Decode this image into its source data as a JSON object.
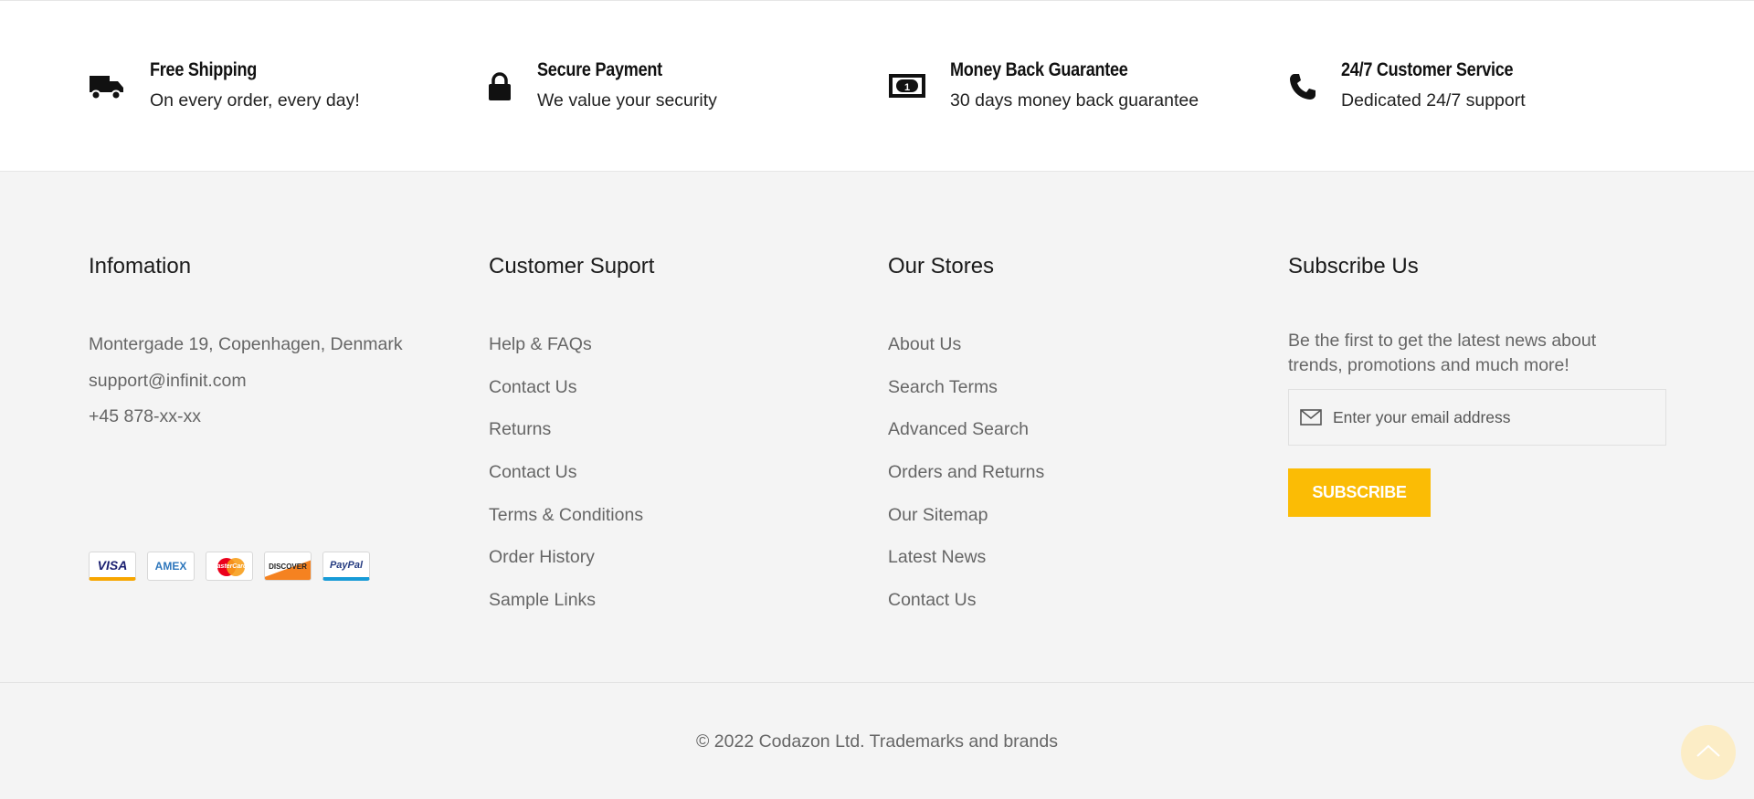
{
  "services": [
    {
      "icon": "truck-icon",
      "title": "Free Shipping",
      "desc": "On every order, every day!"
    },
    {
      "icon": "lock-icon",
      "title": "Secure Payment",
      "desc": "We value your security"
    },
    {
      "icon": "money-icon",
      "title": "Money Back Guarantee",
      "desc": "30 days money back guarantee"
    },
    {
      "icon": "phone-icon",
      "title": "24/7 Customer Service",
      "desc": "Dedicated 24/7 support"
    }
  ],
  "info": {
    "title": "Infomation",
    "address": "Montergade 19, Copenhagen, Denmark",
    "email": "support@infinit.com",
    "phone": "+45 878-xx-xx",
    "cards": [
      "VISA",
      "AMEX",
      "MasterCard",
      "DISCOVER",
      "PayPal"
    ]
  },
  "support": {
    "title": "Customer Suport",
    "links": [
      "Help & FAQs",
      "Contact Us",
      "Returns",
      "Contact Us",
      "Terms & Conditions",
      "Order History",
      "Sample Links"
    ]
  },
  "stores": {
    "title": "Our Stores",
    "links": [
      "About Us",
      "Search Terms",
      "Advanced Search",
      "Orders and Returns",
      "Our Sitemap",
      "Latest News",
      "Contact Us"
    ]
  },
  "subscribe": {
    "title": "Subscribe Us",
    "text": "Be the first to get the latest news about trends, promotions and much more!",
    "placeholder": "Enter your email address",
    "button": "SUBSCRIBE"
  },
  "copyright": "© 2022 Codazon Ltd. Trademarks and brands",
  "colors": {
    "accent": "#fbbc05",
    "footer_bg": "#f4f4f4",
    "link": "#666666"
  }
}
